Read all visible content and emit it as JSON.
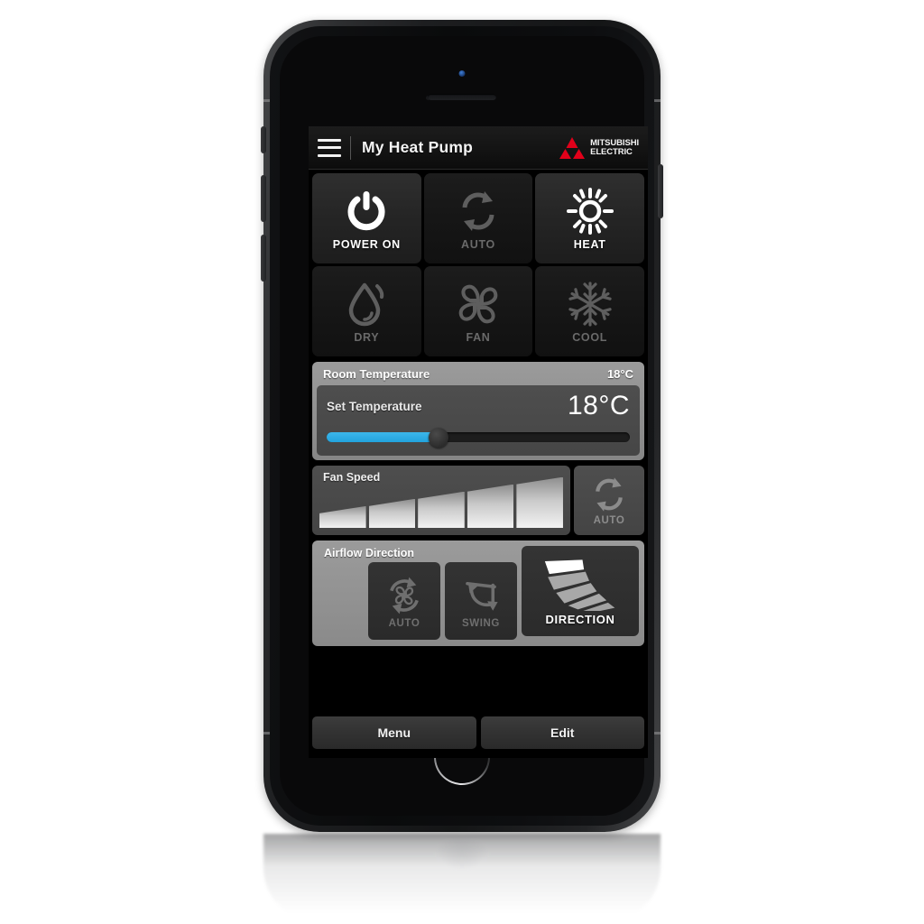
{
  "header": {
    "menu_icon": "hamburger-menu-icon",
    "title": "My Heat Pump",
    "brand_line1": "MITSUBISHI",
    "brand_line2": "ELECTRIC",
    "brand_color": "#e2001a"
  },
  "modes": [
    {
      "label": "POWER ON",
      "icon": "power-icon",
      "state": "on"
    },
    {
      "label": "AUTO",
      "icon": "auto-cycle-icon",
      "state": "dim"
    },
    {
      "label": "HEAT",
      "icon": "sun-icon",
      "state": "on"
    },
    {
      "label": "DRY",
      "icon": "water-drop-icon",
      "state": "dim"
    },
    {
      "label": "FAN",
      "icon": "fan-blades-icon",
      "state": "dim"
    },
    {
      "label": "COOL",
      "icon": "snowflake-icon",
      "state": "dim"
    }
  ],
  "temperature": {
    "room_label": "Room Temperature",
    "room_value": "18°C",
    "set_label": "Set Temperature",
    "set_value": "18°C",
    "slider_percent": 37,
    "slider_fill_color": "#22a3dd"
  },
  "fan_speed": {
    "label": "Fan Speed",
    "bars": 5,
    "auto_label": "AUTO",
    "auto_icon": "auto-cycle-icon",
    "auto_state": "dim"
  },
  "airflow": {
    "label": "Airflow Direction",
    "buttons": [
      {
        "label": "AUTO",
        "icon": "auto-fan-cycle-icon",
        "state": "dim"
      },
      {
        "label": "SWING",
        "icon": "swing-arrow-icon",
        "state": "dim"
      },
      {
        "label": "DIRECTION",
        "icon": "vane-direction-icon",
        "state": "on"
      }
    ]
  },
  "footer": {
    "menu_label": "Menu",
    "edit_label": "Edit"
  }
}
